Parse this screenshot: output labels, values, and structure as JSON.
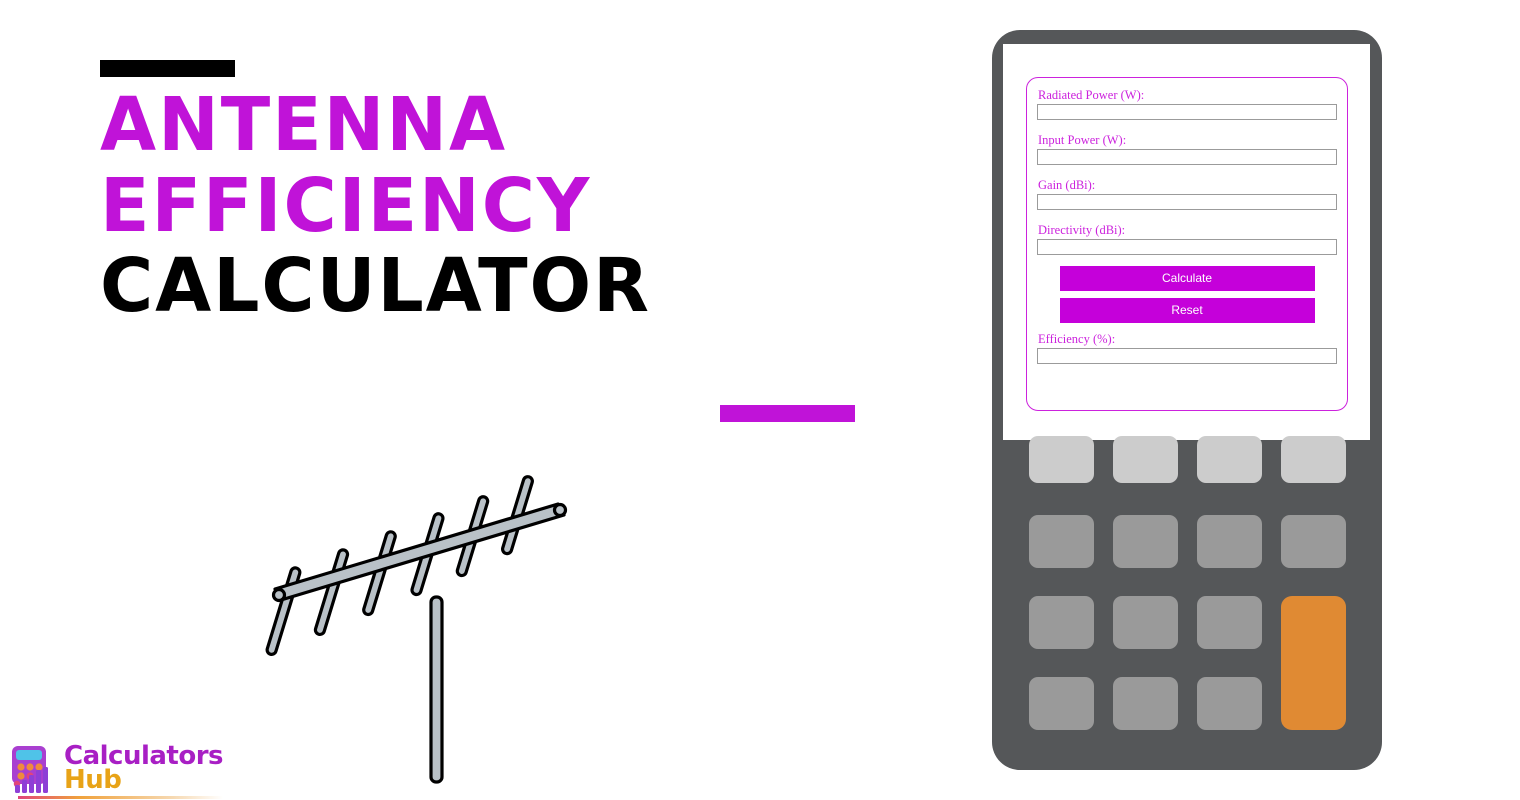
{
  "headline": {
    "line1": "ANTENNA",
    "line2": "EFFICIENCY",
    "line3": "CALCULATOR",
    "accent_color": "#C013D8",
    "text_color": "#000000"
  },
  "illustration": {
    "name": "yagi-antenna",
    "body_color": "#B8C0C6",
    "outline_color": "#000000"
  },
  "logo": {
    "line1": "Calculators",
    "line2": "Hub",
    "line1_color": "#A81FC4",
    "line2_color": "#E8A317",
    "icon": "calculator-bars-icon"
  },
  "calculator": {
    "body_color": "#555759",
    "screen_color": "#ffffff",
    "panel_border_color": "#CC22DD",
    "fields": [
      {
        "label": "Radiated Power (W):",
        "value": "",
        "placeholder": "",
        "name": "radiated-power"
      },
      {
        "label": "Input Power (W):",
        "value": "",
        "placeholder": "",
        "name": "input-power"
      },
      {
        "label": "Gain (dBi):",
        "value": "",
        "placeholder": "",
        "name": "gain"
      },
      {
        "label": "Directivity (dBi):",
        "value": "",
        "placeholder": "",
        "name": "directivity"
      }
    ],
    "buttons": {
      "calculate": "Calculate",
      "reset": "Reset",
      "color": "#C500DA",
      "text_color": "#ffffff"
    },
    "result": {
      "label": "Efficiency (%):",
      "value": "",
      "placeholder": ""
    },
    "keypad": {
      "rows": 4,
      "cols": 4,
      "light_key_color": "#CCCCCC",
      "gray_key_color": "#9A9A9A",
      "accent_key_color": "#E08A33"
    }
  }
}
